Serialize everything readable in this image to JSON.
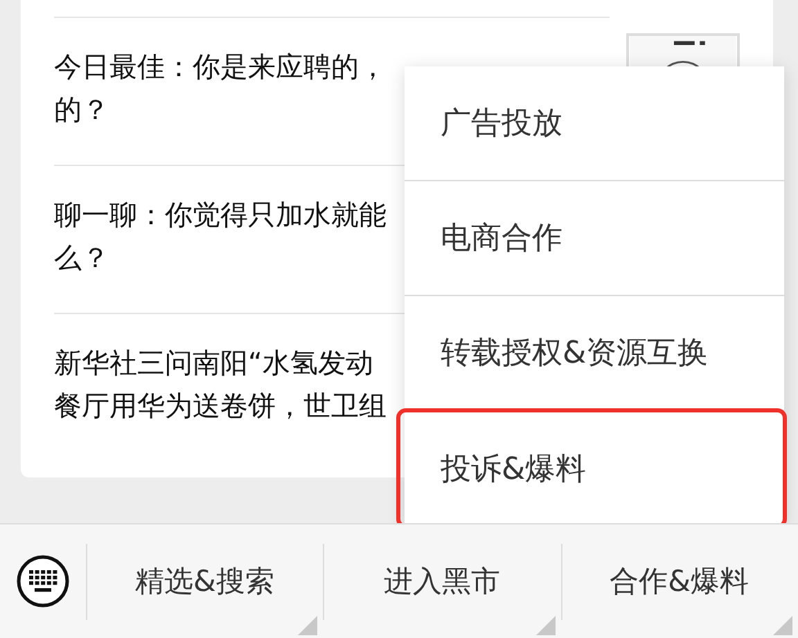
{
  "articles": [
    {
      "lines": [
        "今日最佳：你是来应聘的，",
        "的？"
      ]
    },
    {
      "lines": [
        "聊一聊：你觉得只加水就能",
        "么？"
      ]
    },
    {
      "lines": [
        "新华社三问南阳“水氢发动",
        "餐厅用华为送卷饼，世卫组"
      ]
    }
  ],
  "menu": {
    "items": [
      {
        "label": "广告投放",
        "highlighted": false
      },
      {
        "label": "电商合作",
        "highlighted": false
      },
      {
        "label": "转载授权&资源互换",
        "highlighted": false
      },
      {
        "label": "投诉&爆料",
        "highlighted": true
      }
    ]
  },
  "bottom_bar": {
    "tabs": [
      {
        "label": "精选&搜索"
      },
      {
        "label": "进入黑市"
      },
      {
        "label": "合作&爆料"
      }
    ]
  }
}
